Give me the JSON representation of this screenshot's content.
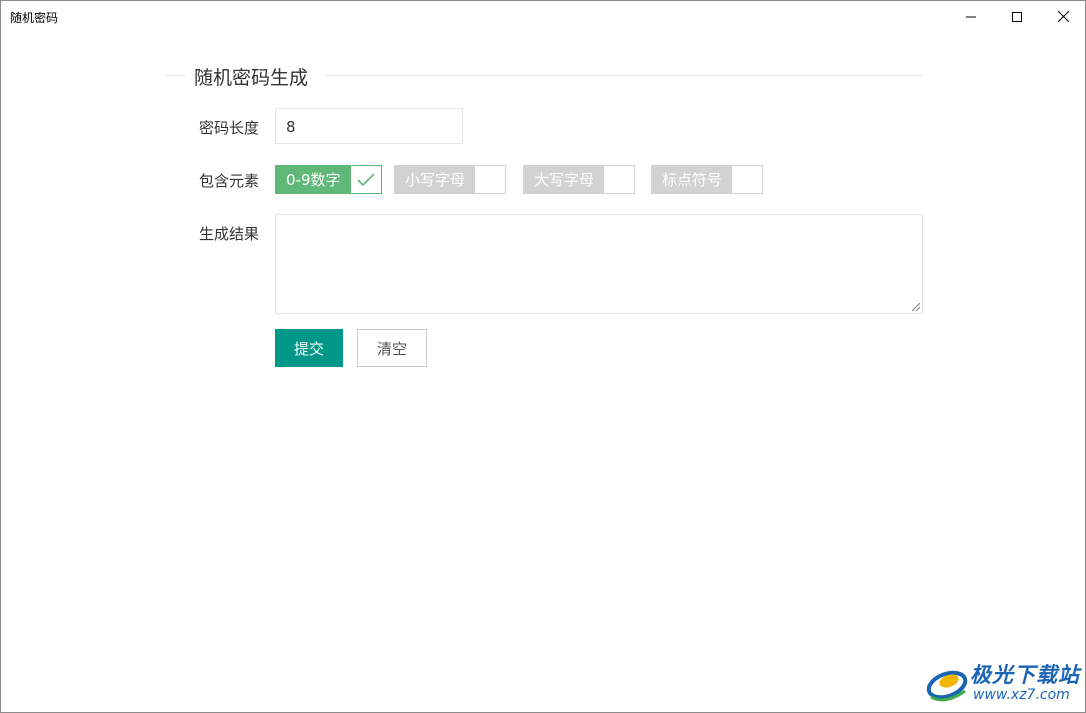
{
  "window": {
    "title": "随机密码",
    "controls": [
      "minimize-icon",
      "maximize-icon",
      "close-icon"
    ]
  },
  "form": {
    "legend": "随机密码生成",
    "length_label": "密码长度",
    "length_value": "8",
    "elements_label": "包含元素",
    "options": [
      {
        "label": "0-9数字",
        "checked": true
      },
      {
        "label": "小写字母",
        "checked": false
      },
      {
        "label": "大写字母",
        "checked": false
      },
      {
        "label": "标点符号",
        "checked": false
      }
    ],
    "result_label": "生成结果",
    "result_value": "",
    "submit_label": "提交",
    "clear_label": "清空"
  },
  "watermark": {
    "title": "极光下载站",
    "url": "www.xz7.com"
  },
  "colors": {
    "checked": "#5fb878",
    "unchecked": "#d2d2d2",
    "primary_button": "#009688",
    "watermark": "#1a64b4"
  }
}
